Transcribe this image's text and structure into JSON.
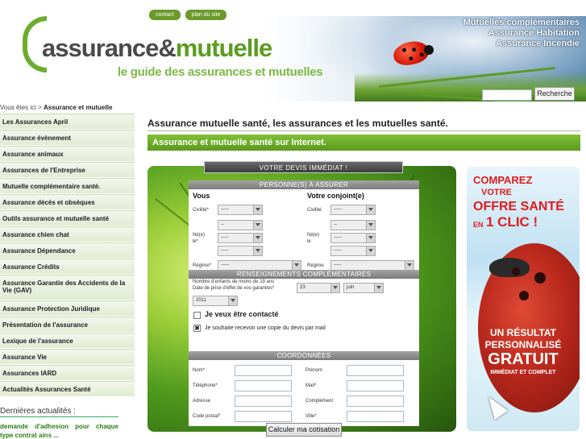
{
  "header": {
    "top_links": [
      "contact",
      "plan du site"
    ],
    "logo_part1": "assurance",
    "logo_amp": "&",
    "logo_part2": "mutuelle",
    "tagline": "le guide des assurances et mutuelles",
    "banner_titles": [
      "Mutuelles complémentaires",
      "Assurance Habitation",
      "Assurance Incendie"
    ],
    "search_value": "",
    "search_button": "Recherche"
  },
  "breadcrumb": {
    "prefix": "Vous êtes ici > ",
    "current": "Assurance et mutuelle"
  },
  "sidebar": {
    "items": [
      "Les Assurances April",
      "Assurance évènement",
      "Assurance animaux",
      "Assurances de l'Entreprise",
      "Mutuelle complémentaire santé.",
      "Assurance décès et obsèques",
      "Outils assurance et mutuelle santé",
      "Assurance chien chat",
      "Assurance Dépendance",
      "Assurance Crédits",
      "Assurance Garantie des Accidents de la Vie (GAV)",
      "Assurance Protection Juridique",
      "Présentation de l'assurance",
      "Lexique de l'assurance",
      "Assurance Vie",
      "Assurances IARD",
      "Actualités Assurances Santé"
    ],
    "news_title": "Dernières actualités :",
    "news_text": "demande d'adhesion pour chaque type contrat ains ..."
  },
  "main": {
    "title": "Assurance mutuelle santé, les assurances et les mutuelles santé.",
    "subtitle": "Assurance et mutuelle santé sur Internet."
  },
  "form": {
    "top_title": "VOTRE DEVIS IMMÉDIAT !",
    "section_persons": "PERSONNE(S) À ASSURER",
    "you_title": "Vous",
    "spouse_title": "Votre conjoint(e)",
    "civility_label": "Civilité*",
    "civility_label_spouse": "Civilité",
    "civility_value": "-----",
    "born_label_1": "Né(e)",
    "born_label_2": "le*",
    "born_label_spouse_2": "le",
    "day_value": "--",
    "month_value": "-----",
    "year_value": "-----",
    "regime_label": "Régime*",
    "regime_label_spouse": "Régime",
    "regime_value": "-----",
    "section_info": "RENSEIGNEMENTS COMPLÉMENTAIRES",
    "children_label": "Nombre d'enfants de moins de 19 ans",
    "date_label": "Date de prise d'effet de vos garanties*",
    "date_day": "23",
    "date_month": "juin",
    "date_year": "2011",
    "call_label": "Je veux être contacté",
    "copy_label": "Je souhaite recevoir une copie du devis par mail",
    "copy_checked_mark": "✖",
    "section_contact": "COORDONNÉES",
    "fields_left": [
      "Nom*",
      "Téléphone*",
      "Adresse",
      "Code postal*"
    ],
    "fields_right": [
      "Prénom",
      "Mail*",
      "Complément",
      "Ville*"
    ],
    "submit": "Calculer ma cotisation"
  },
  "ad": {
    "line1": "COMPAREZ",
    "line2": "VOTRE",
    "line3": "OFFRE SANTÉ",
    "line4a": "EN",
    "line4b": "1 CLIC !",
    "line5": "UN RÉSULTAT",
    "line6": "PERSONNALISÉ",
    "line7": "GRATUIT",
    "line8": "IMMÉDIAT ET COMPLET"
  },
  "colors": {
    "accent_green": "#5a9a1c",
    "ad_red": "#e11b1b"
  }
}
